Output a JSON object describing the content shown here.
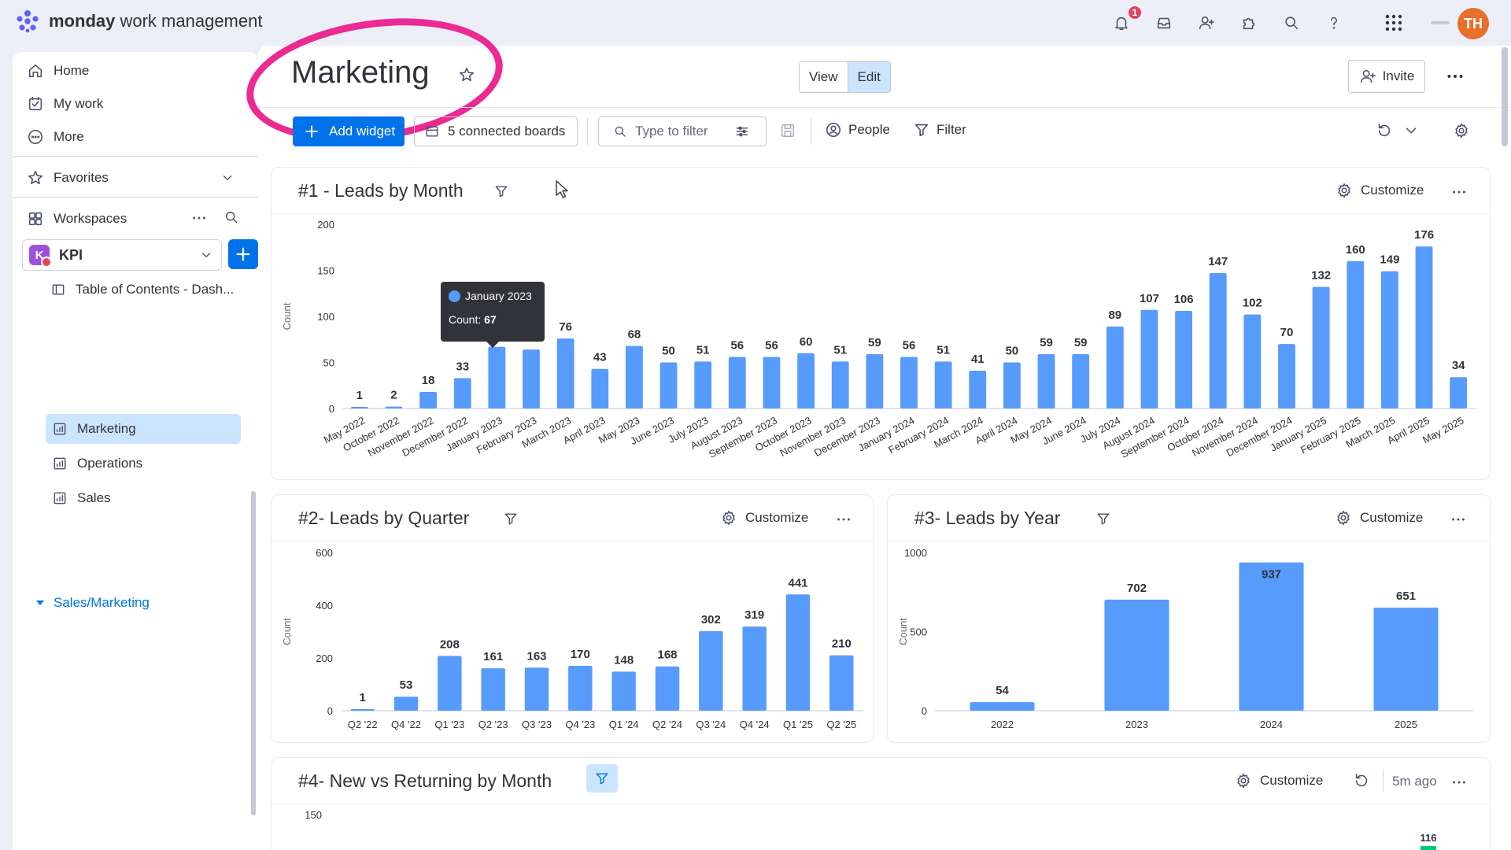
{
  "app": {
    "logo_brand": "monday",
    "logo_product": "work management",
    "notification_count": "1",
    "avatar_initials": "TH"
  },
  "sidebar": {
    "nav": [
      {
        "label": "Home",
        "icon": "home-icon"
      },
      {
        "label": "My work",
        "icon": "checkbox-icon"
      },
      {
        "label": "More",
        "icon": "more-circle-icon"
      }
    ],
    "favorites_label": "Favorites",
    "workspaces_label": "Workspaces",
    "workspace_name": "KPI",
    "workspace_initial": "K",
    "table_of_contents": "Table of Contents - Dash...",
    "boards": [
      "Marketing",
      "Operations",
      "Sales"
    ],
    "active_board": "Marketing",
    "folder": "Sales/Marketing"
  },
  "header": {
    "title": "Marketing",
    "view_label": "View",
    "edit_label": "Edit",
    "invite_label": "Invite"
  },
  "toolbar": {
    "add_widget_label": "Add widget",
    "connected_boards_label": "5 connected boards",
    "filter_placeholder": "Type to filter",
    "people_label": "People",
    "filter_label": "Filter"
  },
  "widgets": {
    "w1": {
      "title": "#1 - Leads by Month",
      "customize": "Customize"
    },
    "w2": {
      "title": "#2- Leads by Quarter",
      "customize": "Customize"
    },
    "w3": {
      "title": "#3- Leads by Year",
      "customize": "Customize"
    },
    "w4": {
      "title": "#4- New vs Returning by Month",
      "customize": "Customize",
      "updated": "5m ago"
    }
  },
  "tooltip": {
    "category": "January 2023",
    "label": "Count:",
    "value": "67"
  },
  "colors": {
    "bar": "#579bfc",
    "accent": "#0073ea",
    "highlight": "#ec2a93"
  },
  "chart_data": [
    {
      "id": "w1",
      "type": "bar",
      "ylabel": "Count",
      "ylim": [
        0,
        200
      ],
      "yticks": [
        0,
        50,
        100,
        150,
        200
      ],
      "categories": [
        "May 2022",
        "October 2022",
        "November 2022",
        "December 2022",
        "January 2023",
        "February 2023",
        "March 2023",
        "April 2023",
        "May 2023",
        "June 2023",
        "July 2023",
        "August 2023",
        "September 2023",
        "October 2023",
        "November 2023",
        "December 2023",
        "January 2024",
        "February 2024",
        "March 2024",
        "April 2024",
        "May 2024",
        "June 2024",
        "July 2024",
        "August 2024",
        "September 2024",
        "October 2024",
        "November 2024",
        "December 2024",
        "January 2025",
        "February 2025",
        "March 2025",
        "April 2025",
        "May 2025"
      ],
      "values": [
        1,
        2,
        18,
        33,
        67,
        64,
        76,
        43,
        68,
        50,
        51,
        56,
        56,
        60,
        51,
        59,
        56,
        51,
        41,
        50,
        59,
        59,
        89,
        107,
        106,
        147,
        102,
        70,
        132,
        160,
        149,
        176,
        34
      ],
      "data_labels": [
        "1",
        "2",
        "18",
        "33",
        "",
        "",
        "76",
        "43",
        "68",
        "50",
        "51",
        "56",
        "56",
        "60",
        "51",
        "59",
        "56",
        "51",
        "41",
        "50",
        "59",
        "59",
        "89",
        "107",
        "106",
        "147",
        "102",
        "70",
        "132",
        "160",
        "149",
        "176",
        "34"
      ]
    },
    {
      "id": "w2",
      "type": "bar",
      "ylabel": "Count",
      "ylim": [
        0,
        600
      ],
      "yticks": [
        0,
        200,
        400,
        600
      ],
      "categories": [
        "Q2 '22",
        "Q4 '22",
        "Q1 '23",
        "Q2 '23",
        "Q3 '23",
        "Q4 '23",
        "Q1 '24",
        "Q2 '24",
        "Q3 '24",
        "Q4 '24",
        "Q1 '25",
        "Q2 '25"
      ],
      "values": [
        1,
        53,
        208,
        161,
        163,
        170,
        148,
        168,
        302,
        319,
        441,
        210
      ]
    },
    {
      "id": "w3",
      "type": "bar",
      "ylabel": "Count",
      "ylim": [
        0,
        1000
      ],
      "yticks": [
        0,
        500,
        1000
      ],
      "categories": [
        "2022",
        "2023",
        "2024",
        "2025"
      ],
      "values": [
        54,
        702,
        937,
        651
      ]
    },
    {
      "id": "w4",
      "type": "bar",
      "yticks": [
        150
      ],
      "visible_labels": [
        "116"
      ]
    }
  ]
}
